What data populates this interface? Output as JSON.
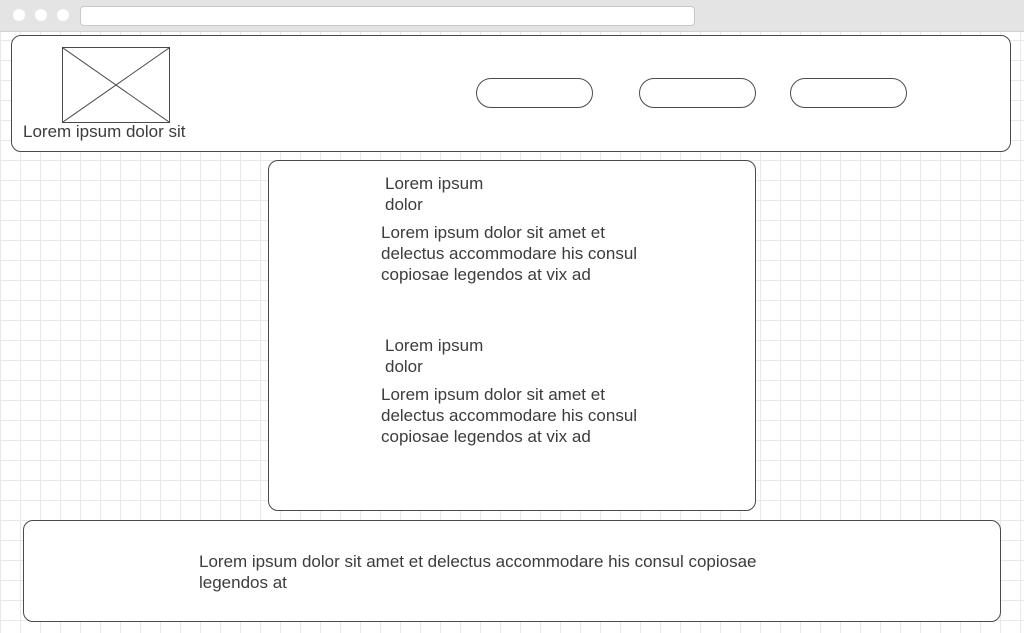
{
  "header": {
    "logo_icon": "image-placeholder-icon",
    "site_name": "Lorem ipsum dolor sit",
    "nav": [
      {
        "label": ""
      },
      {
        "label": ""
      },
      {
        "label": ""
      }
    ]
  },
  "articles": [
    {
      "title": "Lorem ipsum dolor",
      "body": "Lorem ipsum dolor sit amet et delectus accommodare his consul copiosae legendos at vix ad"
    },
    {
      "title": "Lorem ipsum dolor",
      "body": "Lorem ipsum dolor sit amet et delectus accommodare his consul copiosae legendos at vix ad"
    }
  ],
  "footer": {
    "text": "Lorem ipsum dolor sit amet et delectus accommodare his consul copiosae legendos at"
  },
  "colors": {
    "border": "#4a4a4a",
    "text": "#3c3c3c",
    "grid": "#e8e8e8",
    "chrome": "#e4e4e4"
  }
}
